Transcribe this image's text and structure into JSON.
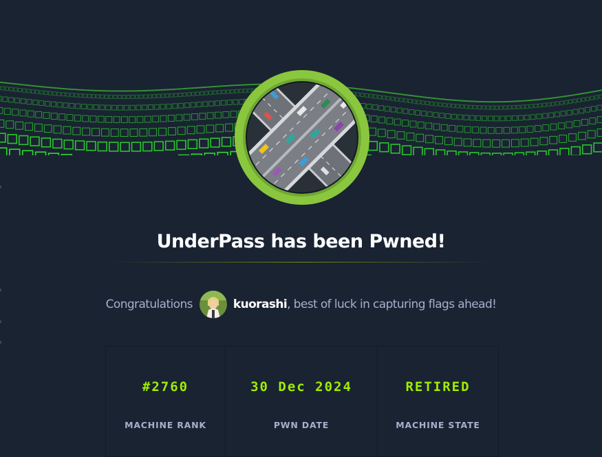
{
  "page": {
    "title": "UnderPass has been Pwned!"
  },
  "congratulations": {
    "prefix": "Congratulations",
    "username": "kuorashi",
    "suffix": ", best of luck in capturing flags ahead!"
  },
  "stats": [
    {
      "value": "#2760",
      "label": "MACHINE RANK"
    },
    {
      "value": "30 Dec 2024",
      "label": "PWN DATE"
    },
    {
      "value": "RETIRED",
      "label": "MACHINE STATE"
    }
  ],
  "colors": {
    "background": "#1a2332",
    "accent": "#9fef00",
    "muted_text": "#a4b1cd",
    "avatar_ring": "#8ac73e"
  },
  "icons": {
    "banner": "green-cube-wave-banner",
    "machine": "underpass-highway-machine-icon",
    "user": "kuorashi-user-avatar"
  }
}
